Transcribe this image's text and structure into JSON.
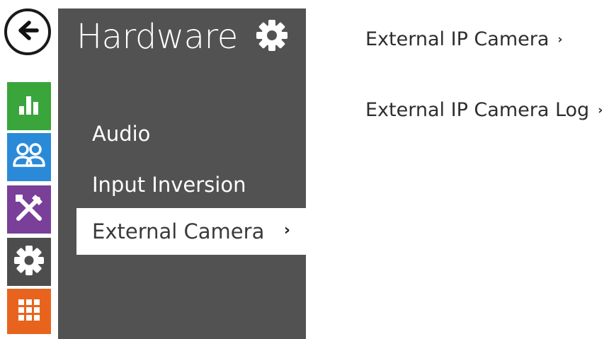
{
  "rail": {
    "items": [
      {
        "name": "status",
        "color": "#3aa53a"
      },
      {
        "name": "directory",
        "color": "#2a8ad8"
      },
      {
        "name": "services",
        "color": "#7a3f98"
      },
      {
        "name": "hardware",
        "color": "#4d4d4d"
      },
      {
        "name": "system",
        "color": "#e8641e"
      }
    ]
  },
  "panel": {
    "title": "Hardware",
    "items": [
      {
        "label": "Audio"
      },
      {
        "label": "Input Inversion"
      },
      {
        "label": "External Camera",
        "chevron": "›",
        "selected": true
      }
    ]
  },
  "main": {
    "links": [
      {
        "label": "External IP Camera",
        "chevron": "›"
      },
      {
        "label": "External IP Camera Log",
        "chevron": "›"
      }
    ]
  }
}
